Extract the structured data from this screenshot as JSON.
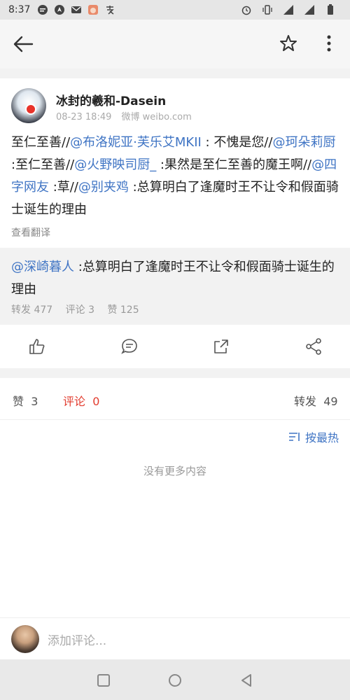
{
  "status_bar": {
    "time": "8:37",
    "network": "4G"
  },
  "app_bar": {
    "back_icon": "back-arrow-icon",
    "star_icon": "star-icon",
    "more_icon": "more-vert-icon"
  },
  "post": {
    "author": "冰封的羲和-Dasein",
    "date": "08-23 18:49",
    "source": "微博 weibo.com",
    "segments": [
      {
        "t": "至仁至善//",
        "at": false
      },
      {
        "t": "@布洛妮亚·芙乐艾MKII",
        "at": true
      },
      {
        "t": " : 不愧是您//",
        "at": false
      },
      {
        "t": "@珂朵莉厨",
        "at": true
      },
      {
        "t": " :至仁至善//",
        "at": false
      },
      {
        "t": "@火野映司厨_",
        "at": true
      },
      {
        "t": " :果然是至仁至善的魔王啊//",
        "at": false
      },
      {
        "t": "@四字网友",
        "at": true
      },
      {
        "t": " :草//",
        "at": false
      },
      {
        "t": "@别夹鸡",
        "at": true
      },
      {
        "t": " :总算明白了逢魔时王不让令和假面骑士诞生的理由",
        "at": false
      }
    ],
    "translate": "查看翻译"
  },
  "repost": {
    "user": "@深崎暮人",
    "text": " :总算明白了逢魔时王不让令和假面骑士诞生的理由",
    "stats": {
      "forward": "转发 477",
      "comment": "评论 3",
      "like": "赞 125"
    }
  },
  "tabs": {
    "like": "赞",
    "like_count": "3",
    "comment": "评论",
    "comment_count": "0",
    "forward": "转发",
    "forward_count": "49"
  },
  "comments": {
    "sort_label": "按最热",
    "empty": "没有更多内容"
  },
  "input": {
    "placeholder": "添加评论..."
  }
}
